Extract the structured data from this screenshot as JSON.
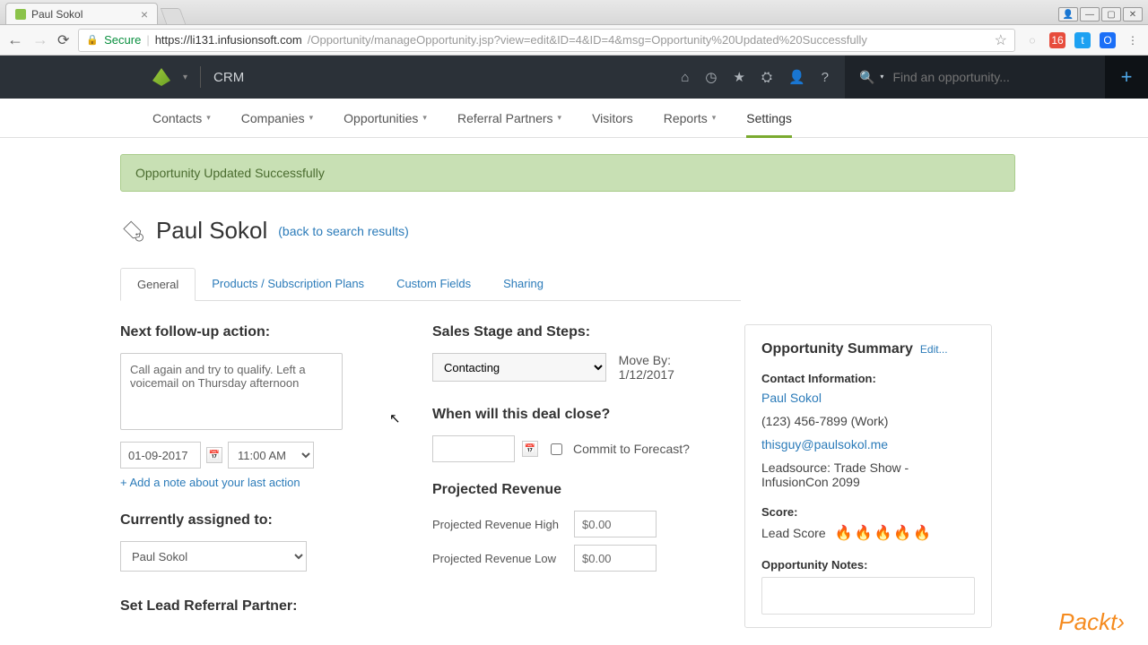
{
  "browser": {
    "tab_title": "Paul Sokol",
    "url_secure": "Secure",
    "url_host": "https://li131.infusionsoft.com",
    "url_path": "/Opportunity/manageOpportunity.jsp?view=edit&ID=4&ID=4&msg=Opportunity%20Updated%20Successfully"
  },
  "appbar": {
    "name": "CRM",
    "search_placeholder": "Find an opportunity..."
  },
  "subnav": {
    "items": [
      "Contacts",
      "Companies",
      "Opportunities",
      "Referral Partners",
      "Visitors",
      "Reports",
      "Settings"
    ],
    "active": "Settings"
  },
  "alert": "Opportunity Updated Successfully",
  "header": {
    "title": "Paul Sokol",
    "back": "(back to search results)"
  },
  "tabs": {
    "items": [
      "General",
      "Products / Subscription Plans",
      "Custom Fields",
      "Sharing"
    ],
    "active": "General"
  },
  "left": {
    "followup_h": "Next follow-up action:",
    "followup_text": "Call again and try to qualify. Left a voicemail on Thursday afternoon",
    "date": "01-09-2017",
    "time": "11:00 AM",
    "add_note": "+ Add a note about your last action",
    "assigned_h": "Currently assigned to:",
    "assigned_val": "Paul Sokol",
    "referral_h": "Set Lead Referral Partner:"
  },
  "mid": {
    "stage_h": "Sales Stage and Steps:",
    "stage_val": "Contacting",
    "moveby": "Move By: 1/12/2017",
    "close_h": "When will this deal close?",
    "commit": "Commit to Forecast?",
    "rev_h": "Projected Revenue",
    "rev_high_l": "Projected Revenue High",
    "rev_high_v": "$0.00",
    "rev_low_l": "Projected Revenue Low",
    "rev_low_v": "$0.00"
  },
  "right": {
    "title": "Opportunity Summary",
    "edit": "Edit...",
    "contact_h": "Contact Information:",
    "contact_name": "Paul Sokol",
    "phone": "(123) 456-7899 (Work)",
    "email": "thisguy@paulsokol.me",
    "leadsource": "Leadsource: Trade Show - InfusionCon 2099",
    "score_h": "Score:",
    "score_l": "Lead Score",
    "notes_h": "Opportunity Notes:"
  },
  "watermark": "Packt"
}
